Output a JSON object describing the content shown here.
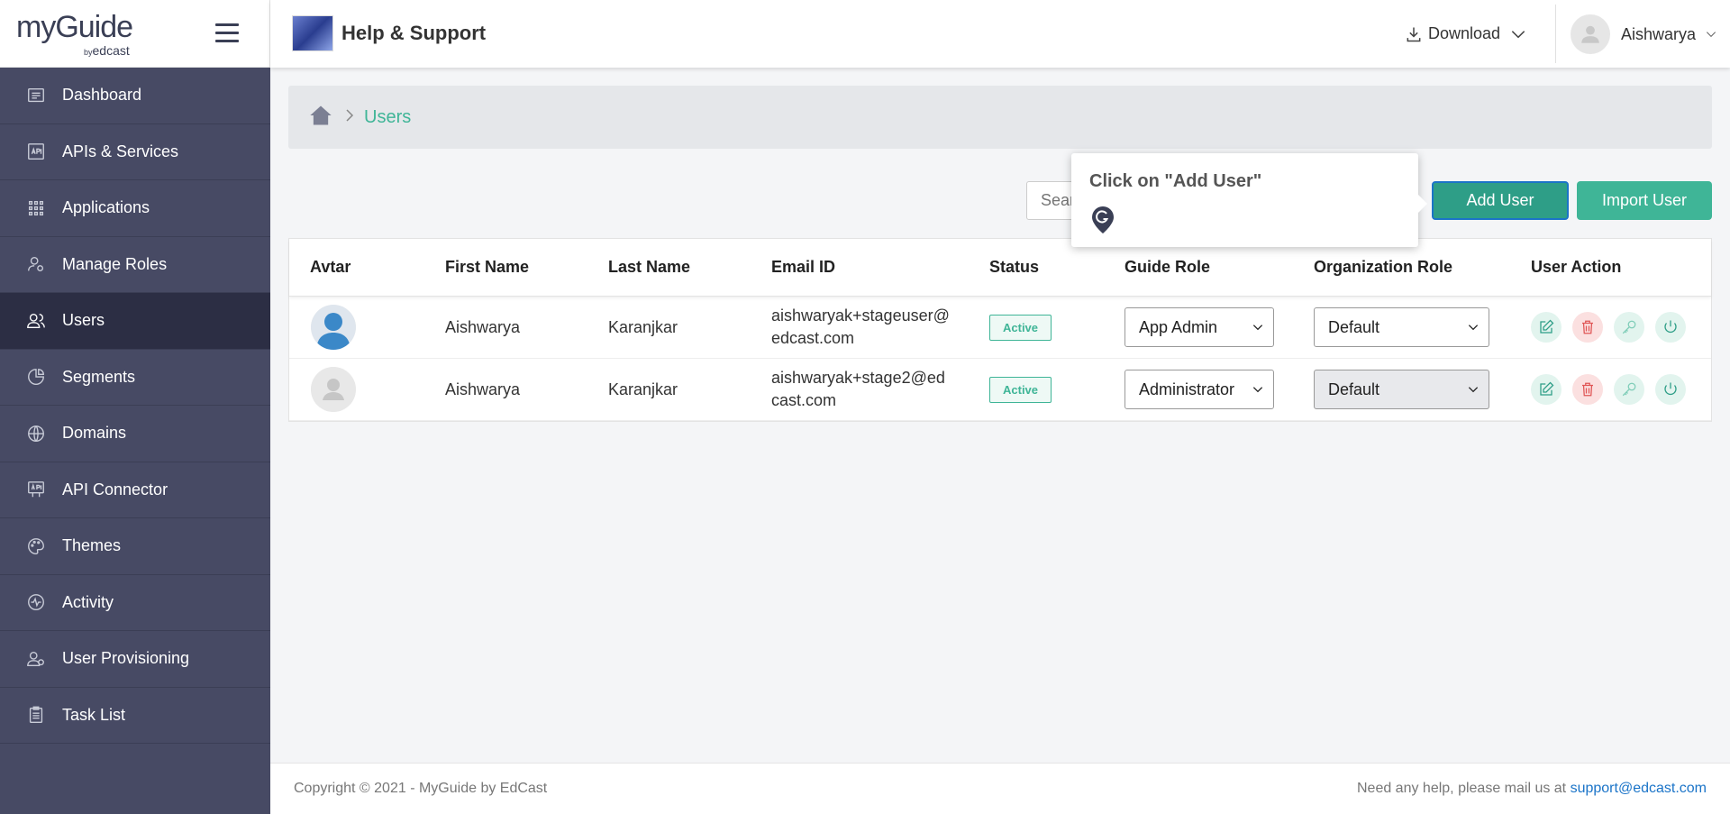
{
  "logo": {
    "brand": "myGuide",
    "by": "by",
    "company": "edcast"
  },
  "sidebar": {
    "items": [
      {
        "label": "Dashboard",
        "icon": "dashboard-icon"
      },
      {
        "label": "APIs & Services",
        "icon": "api-icon"
      },
      {
        "label": "Applications",
        "icon": "grid-icon"
      },
      {
        "label": "Manage Roles",
        "icon": "user-gear-icon"
      },
      {
        "label": "Users",
        "icon": "users-icon"
      },
      {
        "label": "Segments",
        "icon": "pie-chart-icon"
      },
      {
        "label": "Domains",
        "icon": "globe-icon"
      },
      {
        "label": "API Connector",
        "icon": "api-connector-icon"
      },
      {
        "label": "Themes",
        "icon": "palette-icon"
      },
      {
        "label": "Activity",
        "icon": "activity-icon"
      },
      {
        "label": "User Provisioning",
        "icon": "user-provision-icon"
      },
      {
        "label": "Task List",
        "icon": "clipboard-icon"
      }
    ],
    "active": "Users"
  },
  "header": {
    "app_title": "Help & Support",
    "download_label": "Download",
    "user_name": "Aishwarya"
  },
  "breadcrumb": {
    "current": "Users"
  },
  "toolbar": {
    "search_placeholder": "Search",
    "add_user_label": "Add User",
    "import_user_label": "Import User"
  },
  "tooltip": {
    "text": "Click on \"Add User\""
  },
  "table": {
    "columns": [
      "Avtar",
      "First Name",
      "Last Name",
      "Email ID",
      "Status",
      "Guide Role",
      "Organization Role",
      "User Action"
    ],
    "rows": [
      {
        "first": "Aishwarya",
        "last": "Karanjkar",
        "email_line1": "aishwaryak+stageuser@",
        "email_line2": "edcast.com",
        "status": "Active",
        "guide_role": "App Admin",
        "org_role": "Default"
      },
      {
        "first": "Aishwarya",
        "last": "Karanjkar",
        "email_line1": "aishwaryak+stage2@ed",
        "email_line2": "cast.com",
        "status": "Active",
        "guide_role": "Administrator",
        "org_role": "Default"
      }
    ]
  },
  "footer": {
    "copyright": "Copyright © 2021 - MyGuide by EdCast",
    "help_text": "Need any help, please mail us at",
    "email": "support@edcast.com"
  },
  "colors": {
    "sidebar_bg": "#474a64",
    "sidebar_active": "#2c2e44",
    "accent": "#3fb597",
    "link": "#1b74c8"
  }
}
